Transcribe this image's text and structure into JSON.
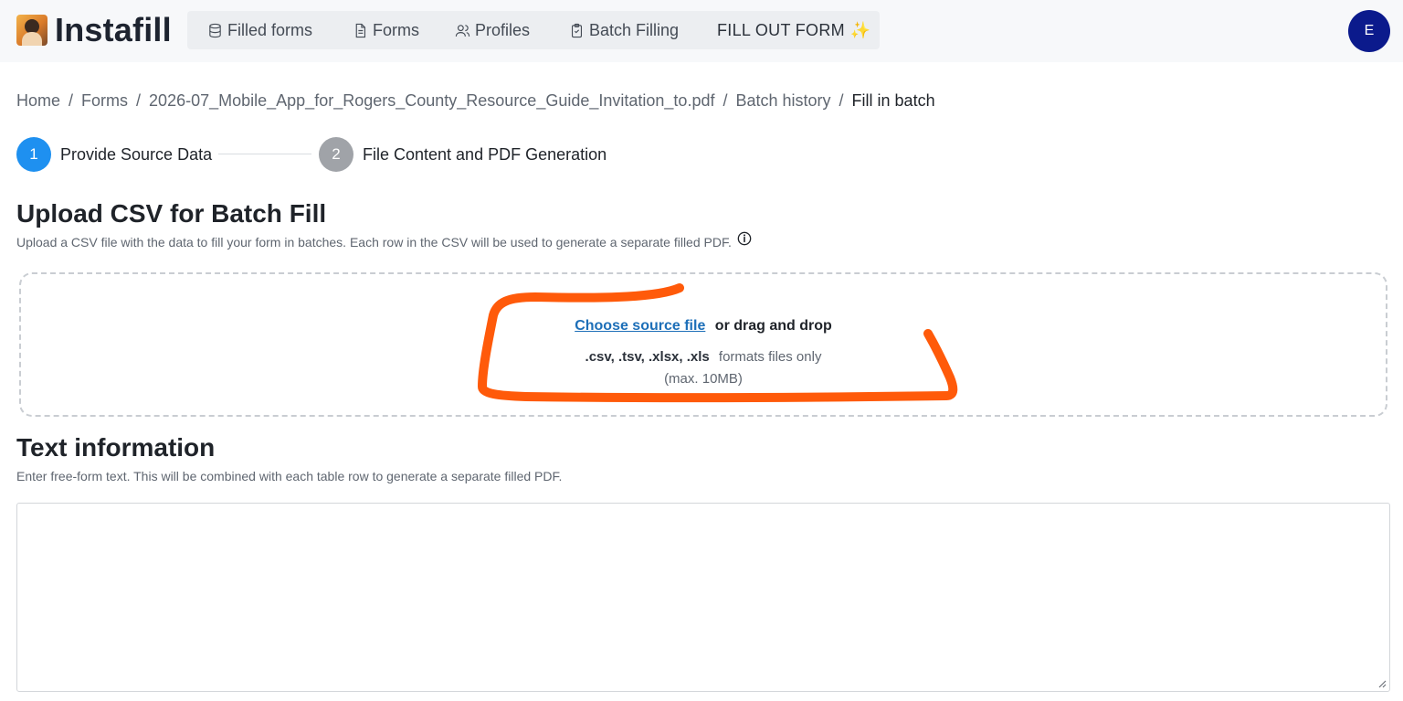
{
  "brand": {
    "name": "Instafill"
  },
  "nav": {
    "items": [
      {
        "label": "Filled forms",
        "icon": "database-icon"
      },
      {
        "label": "Forms",
        "icon": "document-icon"
      },
      {
        "label": "Profiles",
        "icon": "users-icon"
      },
      {
        "label": "Batch Filling",
        "icon": "clipboard-check-icon"
      }
    ],
    "fill_out_form": "FILL OUT FORM",
    "fill_out_form_icon": "sparkle-icon"
  },
  "user": {
    "initial": "E",
    "avatar_color": "#0b1a8c"
  },
  "breadcrumb": [
    "Home",
    "Forms",
    "2026-07_Mobile_App_for_Rogers_County_Resource_Guide_Invitation_to.pdf",
    "Batch history",
    "Fill in batch"
  ],
  "stepper": {
    "steps": [
      {
        "number": "1",
        "label": "Provide Source Data",
        "active": true
      },
      {
        "number": "2",
        "label": "File Content and PDF Generation",
        "active": false
      }
    ],
    "active_color": "#1e90f0"
  },
  "upload": {
    "title": "Upload CSV for Batch Fill",
    "description": "Upload a CSV file with the data to fill your form in batches. Each row in the CSV will be used to generate a separate filled PDF.",
    "choose_label": "Choose source file",
    "drag_label": "or drag and drop",
    "formats": ".csv, .tsv, .xlsx, .xls",
    "formats_suffix": "formats files only",
    "max_size": "(max. 10MB)"
  },
  "text_info": {
    "title": "Text information",
    "description": "Enter free-form text. This will be combined with each table row to generate a separate filled PDF.",
    "value": "",
    "placeholder": ""
  },
  "annotation_color": "#ff5a0a"
}
